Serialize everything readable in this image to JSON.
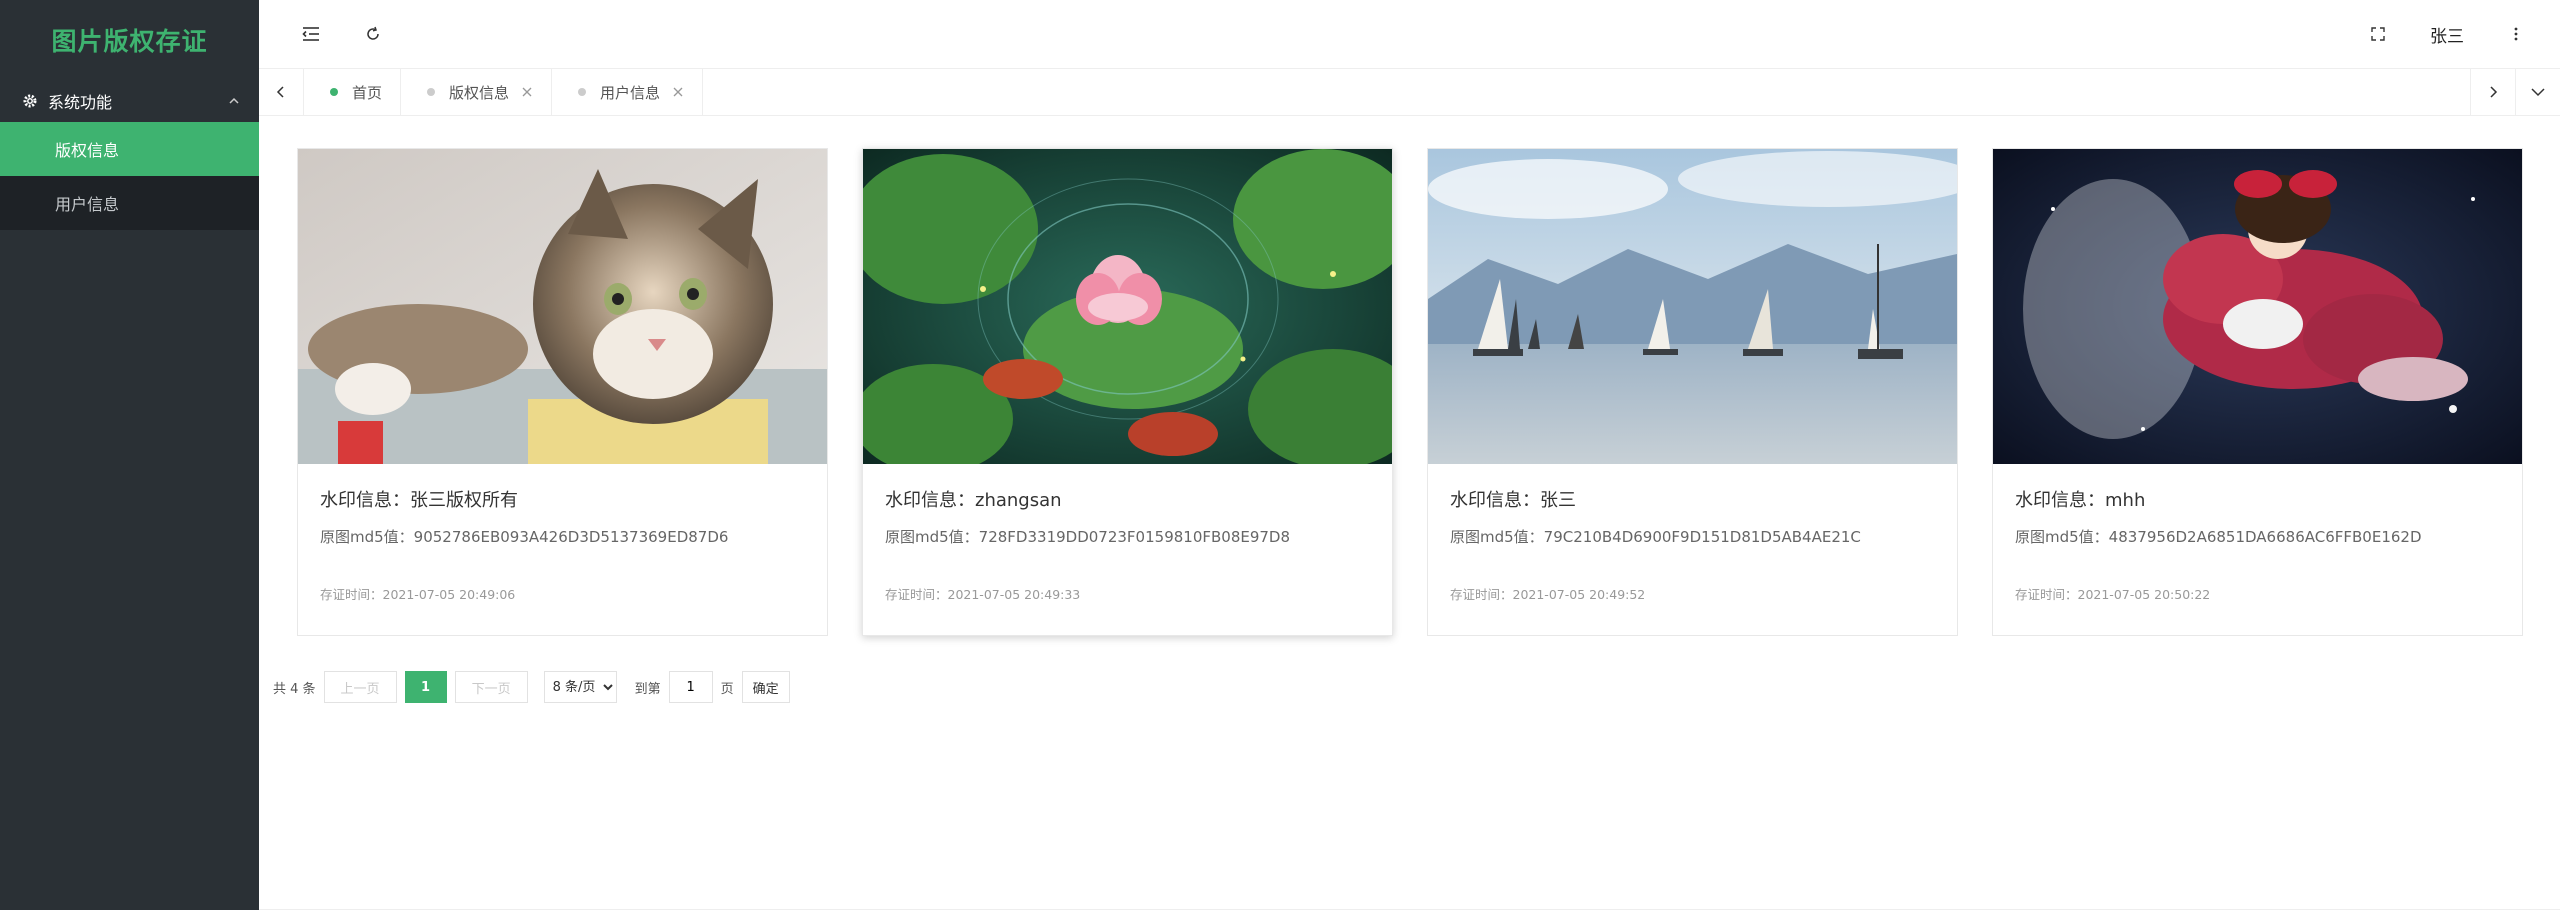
{
  "app": {
    "logo_text": "图片版权存证",
    "accent_color": "#3eb370"
  },
  "sidebar": {
    "group_label": "系统功能",
    "items": [
      {
        "label": "版权信息",
        "active": true
      },
      {
        "label": "用户信息",
        "active": false
      }
    ]
  },
  "topbar": {
    "user_name": "张三",
    "icons": [
      "menu-fold-icon",
      "refresh-icon",
      "fullscreen-icon",
      "more-vertical-icon"
    ]
  },
  "tabs": [
    {
      "label": "首页",
      "active": true,
      "closable": false
    },
    {
      "label": "版权信息",
      "active": false,
      "closable": true
    },
    {
      "label": "用户信息",
      "active": false,
      "closable": true
    }
  ],
  "cards": [
    {
      "title": "水印信息：张三版权所有",
      "md5": "原图md5值：9052786EB093A426D3D5137369ED87D6",
      "time": "存证时间：2021-07-05 20:49:06",
      "image": "cat"
    },
    {
      "title": "水印信息：zhangsan",
      "md5": "原图md5值：728FD3319DD0723F0159810FB08E97D8",
      "time": "存证时间：2021-07-05 20:49:33",
      "image": "lotus"
    },
    {
      "title": "水印信息：张三",
      "md5": "原图md5值：79C210B4D6900F9D151D81D5AB4AE21C",
      "time": "存证时间：2021-07-05 20:49:52",
      "image": "sailboats"
    },
    {
      "title": "水印信息：mhh",
      "md5": "原图md5值：4837956D2A6851DA6686AC6FFB0E162D",
      "time": "存证时间：2021-07-05 20:50:22",
      "image": "anime"
    }
  ],
  "pagination": {
    "total": "共 4 条",
    "prev": "上一页",
    "current": "1",
    "next": "下一页",
    "page_size": "8 条/页",
    "goto_label": "到第",
    "goto_value": "1",
    "page_unit": "页",
    "confirm": "确定"
  }
}
